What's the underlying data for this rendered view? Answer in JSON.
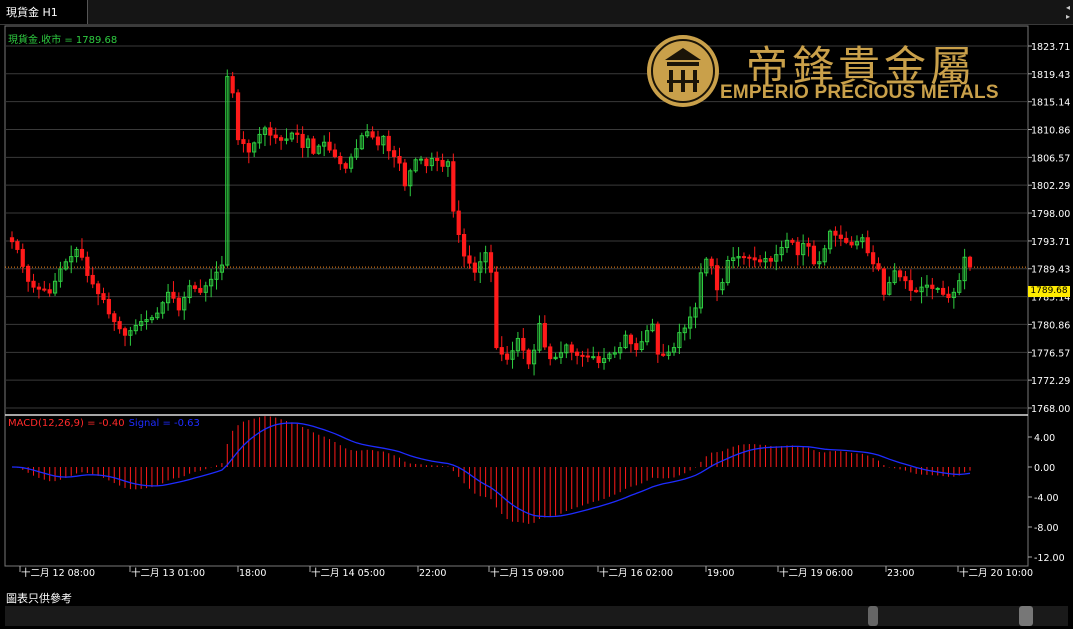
{
  "tab": {
    "label": "現貨金 H1"
  },
  "price_panel": {
    "label": "現貨金.收市 = 1789.68",
    "current_price": "1789.68"
  },
  "macd_panel": {
    "label": "MACD(12,26,9) = -0.40",
    "signal_label": "Signal = -0.63"
  },
  "logo": {
    "cn": "帝鋒貴金屬",
    "en": "EMPERIO PRECIOUS METALS"
  },
  "footer": {
    "note": "圖表只供參考"
  },
  "colors": {
    "up": "#2ecc40",
    "down": "#ff1a1a",
    "macd_hist": "#ff1a1a",
    "signal": "#1e2cff",
    "grid": "#3a3a3a",
    "current_line": "#ff8c1a",
    "logo": "#c9a04a"
  },
  "chart_data": {
    "type": "candlestick",
    "price_axis_ticks": [
      "1823.71",
      "1819.43",
      "1815.14",
      "1810.86",
      "1806.57",
      "1802.29",
      "1798.00",
      "1793.71",
      "1789.43",
      "1785.14",
      "1780.86",
      "1776.57",
      "1772.29",
      "1768.00"
    ],
    "macd_axis_ticks": [
      "4.00",
      "0.00",
      "-4.00",
      "-8.00",
      "-12.00"
    ],
    "time_labels": [
      "十二月 12 08:00",
      "十二月 13 01:00",
      "18:00",
      "十二月 14 05:00",
      "22:00",
      "十二月 15 09:00",
      "十二月 16 02:00",
      "19:00",
      "十二月 19 06:00",
      "23:00",
      "十二月 20 10:00"
    ],
    "closes": [
      1793.6,
      1792.4,
      1789.8,
      1787.5,
      1786.6,
      1786.3,
      1786.2,
      1785.7,
      1787.5,
      1789.4,
      1790.5,
      1791.3,
      1792.4,
      1791.2,
      1788.4,
      1787.1,
      1785.6,
      1784.7,
      1782.5,
      1781.3,
      1780.2,
      1779.2,
      1779.9,
      1780.7,
      1781.3,
      1781.6,
      1781.9,
      1782.6,
      1784.2,
      1785.8,
      1784.9,
      1783.1,
      1785.0,
      1786.8,
      1786.4,
      1785.8,
      1786.8,
      1787.8,
      1788.9,
      1790.0,
      1819.0,
      1816.5,
      1809.3,
      1808.7,
      1807.4,
      1808.8,
      1810.1,
      1811.1,
      1810.0,
      1809.6,
      1809.2,
      1809.4,
      1810.3,
      1810.1,
      1808.1,
      1809.4,
      1807.2,
      1808.3,
      1808.9,
      1807.7,
      1806.7,
      1805.6,
      1804.9,
      1806.6,
      1807.9,
      1809.9,
      1810.5,
      1809.7,
      1808.5,
      1809.8,
      1807.6,
      1806.7,
      1805.7,
      1802.2,
      1804.5,
      1806.2,
      1806.3,
      1805.3,
      1806.4,
      1806.1,
      1805.2,
      1805.9,
      1798.3,
      1794.7,
      1791.4,
      1790.3,
      1788.9,
      1790.5,
      1791.9,
      1788.9,
      1777.3,
      1776.3,
      1775.5,
      1776.8,
      1778.7,
      1776.9,
      1774.8,
      1776.9,
      1781.0,
      1777.4,
      1775.6,
      1775.8,
      1776.5,
      1777.7,
      1776.6,
      1776.1,
      1776.0,
      1775.9,
      1775.9,
      1775.0,
      1775.6,
      1776.3,
      1776.5,
      1777.3,
      1779.2,
      1777.9,
      1777.0,
      1778.2,
      1779.9,
      1780.9,
      1776.3,
      1776.1,
      1776.6,
      1777.3,
      1779.6,
      1780.3,
      1782.0,
      1783.4,
      1788.8,
      1790.9,
      1789.9,
      1786.2,
      1787.3,
      1790.7,
      1791.1,
      1791.3,
      1791.2,
      1791.1,
      1790.8,
      1790.5,
      1791.0,
      1790.6,
      1791.6,
      1792.7,
      1793.8,
      1793.5,
      1791.6,
      1793.3,
      1792.9,
      1790.2,
      1790.5,
      1792.5,
      1795.2,
      1794.6,
      1794.1,
      1793.5,
      1793.1,
      1793.6,
      1794.2,
      1791.9,
      1790.2,
      1789.4,
      1785.5,
      1787.3,
      1789.1,
      1788.2,
      1787.6,
      1786.1,
      1785.9,
      1786.6,
      1786.9,
      1786.4,
      1786.4,
      1785.5,
      1785.0,
      1785.8,
      1787.6,
      1791.2,
      1789.7
    ]
  }
}
